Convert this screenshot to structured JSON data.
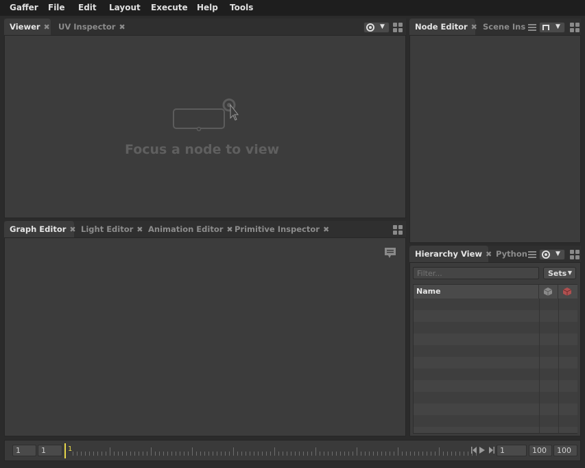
{
  "menubar": {
    "items": [
      "Gaffer",
      "File",
      "Edit",
      "Layout",
      "Execute",
      "Help",
      "Tools"
    ]
  },
  "viewer_panel": {
    "tabs": [
      {
        "label": "Viewer",
        "active": true
      },
      {
        "label": "UV Inspector",
        "active": false
      }
    ],
    "placeholder": "Focus a node to view"
  },
  "node_panel": {
    "tabs": [
      {
        "label": "Node Editor",
        "active": true
      },
      {
        "label": "Scene Insp",
        "active": false
      }
    ]
  },
  "graph_panel": {
    "tabs": [
      {
        "label": "Graph Editor",
        "active": true
      },
      {
        "label": "Light Editor",
        "active": false
      },
      {
        "label": "Animation Editor",
        "active": false
      },
      {
        "label": "Primitive Inspector",
        "active": false
      }
    ]
  },
  "hierarchy_panel": {
    "tabs": [
      {
        "label": "Hierarchy View",
        "active": true
      },
      {
        "label": "Python",
        "active": false
      }
    ],
    "filter_placeholder": "Filter...",
    "sets_label": "Sets",
    "column_name": "Name"
  },
  "timeline": {
    "start_outer": "1",
    "start_inner": "1",
    "current_frame": "1",
    "frame_field": "1",
    "end_inner": "100",
    "end_outer": "100"
  },
  "colors": {
    "accent_frame": "#e8d84a",
    "panel_bg": "#3c3c3c",
    "window_bg": "#2b2b2b"
  }
}
